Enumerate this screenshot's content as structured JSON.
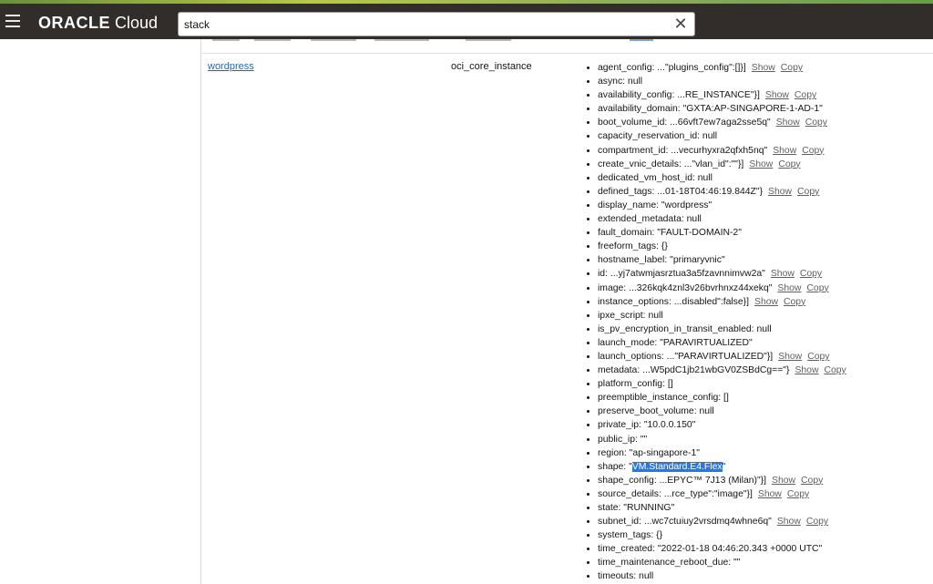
{
  "header": {
    "logo_brand": "ORACLE",
    "logo_product": "Cloud",
    "search_value": "stack",
    "clear_symbol": "✕"
  },
  "resource": {
    "name": "wordpress",
    "type": "oci_core_instance"
  },
  "actions": {
    "show": "Show",
    "copy": "Copy"
  },
  "attributes": [
    {
      "text": "agent_config: ...\"plugins_config\":[]}]",
      "actions": true
    },
    {
      "text": "async: null",
      "actions": false
    },
    {
      "text": "availability_config: ...RE_INSTANCE\"}]",
      "actions": true
    },
    {
      "text": "availability_domain: \"GXTA:AP-SINGAPORE-1-AD-1\"",
      "actions": false
    },
    {
      "text": "boot_volume_id: ...66vft7ew7aga2sse5q\"",
      "actions": true
    },
    {
      "text": "capacity_reservation_id: null",
      "actions": false
    },
    {
      "text": "compartment_id: ...vecurhyxra2qfxh5nq\"",
      "actions": true
    },
    {
      "text": "create_vnic_details: ...\"vlan_id\":\"\"}]",
      "actions": true
    },
    {
      "text": "dedicated_vm_host_id: null",
      "actions": false
    },
    {
      "text": "defined_tags: ...01-18T04:46:19.844Z\"}",
      "actions": true
    },
    {
      "text": "display_name: \"wordpress\"",
      "actions": false
    },
    {
      "text": "extended_metadata: null",
      "actions": false
    },
    {
      "text": "fault_domain: \"FAULT-DOMAIN-2\"",
      "actions": false
    },
    {
      "text": "freeform_tags: {}",
      "actions": false
    },
    {
      "text": "hostname_label: \"primaryvnic\"",
      "actions": false
    },
    {
      "text": "id: ...yj7atwmjasrztua3a5fzavnnimvw2a\"",
      "actions": true
    },
    {
      "text": "image: ...326kqk4znl3v26bvrhnxz44xekq\"",
      "actions": true
    },
    {
      "text": "instance_options: ...disabled\":false}]",
      "actions": true
    },
    {
      "text": "ipxe_script: null",
      "actions": false
    },
    {
      "text": "is_pv_encryption_in_transit_enabled: null",
      "actions": false
    },
    {
      "text": "launch_mode: \"PARAVIRTUALIZED\"",
      "actions": false
    },
    {
      "text": "launch_options: ...\"PARAVIRTUALIZED\"}]",
      "actions": true
    },
    {
      "text": "metadata: ...W5pdC1jb21wbGV0ZSBdCg==\"}",
      "actions": true
    },
    {
      "text": "platform_config: []",
      "actions": false
    },
    {
      "text": "preemptible_instance_config: []",
      "actions": false
    },
    {
      "text": "preserve_boot_volume: null",
      "actions": false
    },
    {
      "text": "private_ip: \"10.0.0.150\"",
      "actions": false
    },
    {
      "text": "public_ip: \"\"",
      "actions": false
    },
    {
      "text": "region: \"ap-singapore-1\"",
      "actions": false
    },
    {
      "text": "shape: \"",
      "highlight": "VM.Standard.E4.Flex",
      "after": "\"",
      "actions": false
    },
    {
      "text": "shape_config: ...EPYC™ 7J13 (Milan)\"}]",
      "actions": true
    },
    {
      "text": "source_details: ...rce_type\":\"image\"}]",
      "actions": true
    },
    {
      "text": "state: \"RUNNING\"",
      "actions": false
    },
    {
      "text": "subnet_id: ...wc7ctuiuy2vrsdmq4whne6q\"",
      "actions": true
    },
    {
      "text": "system_tags: {}",
      "actions": false
    },
    {
      "text": "time_created: \"2022-01-18 04:46:20.343 +0000 UTC\"",
      "actions": false
    },
    {
      "text": "time_maintenance_reboot_due: \"\"",
      "actions": false
    },
    {
      "text": "timeouts: null",
      "actions": false
    }
  ]
}
